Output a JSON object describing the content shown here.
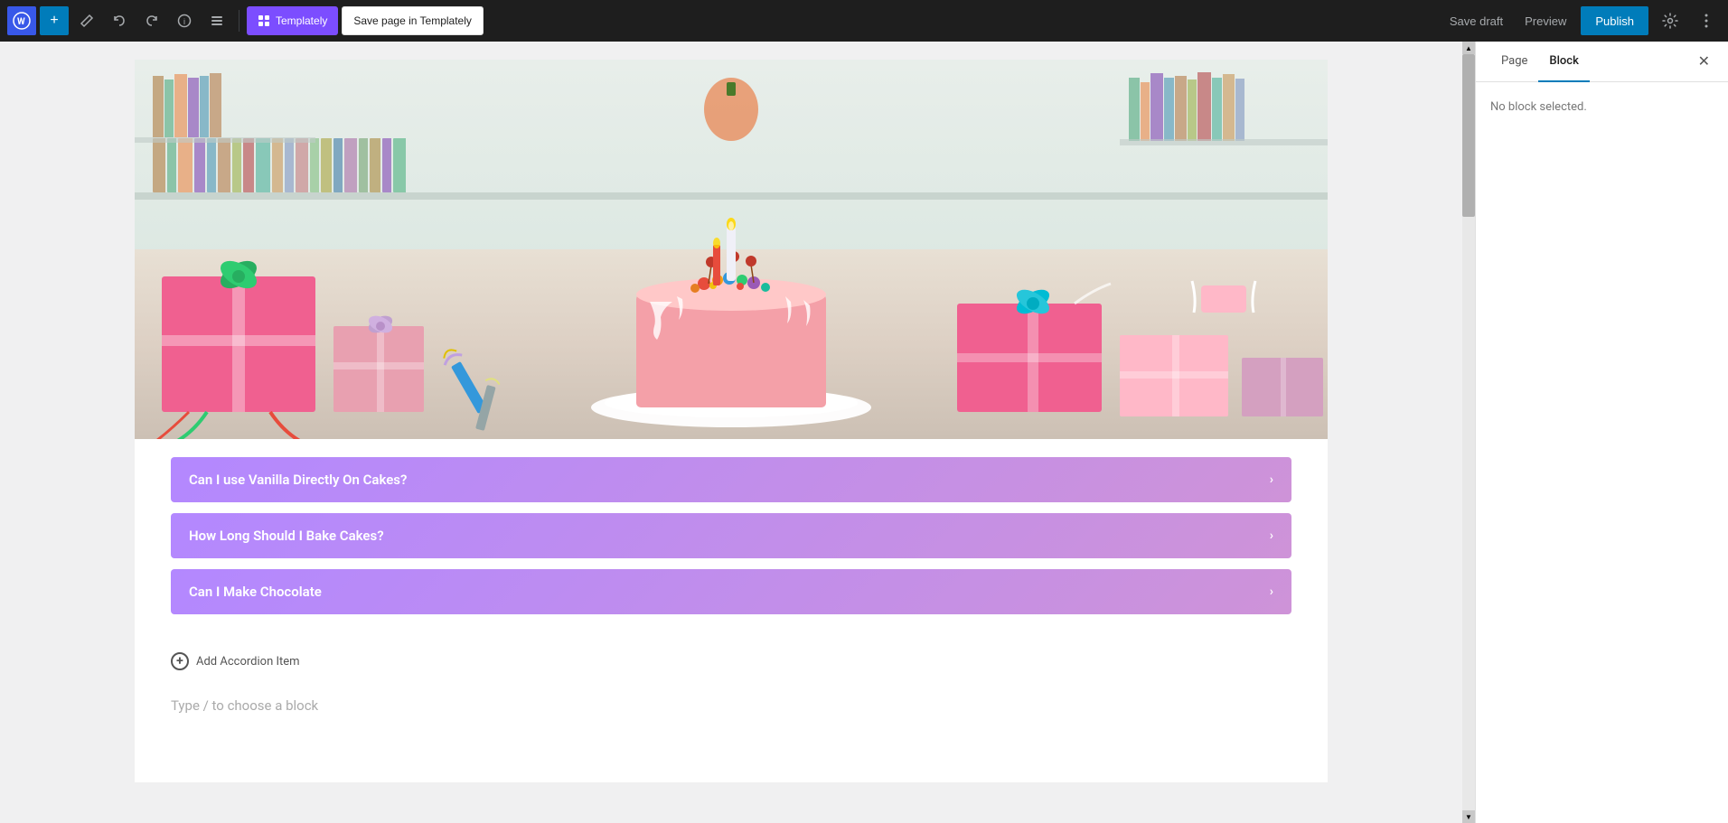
{
  "toolbar": {
    "wp_logo_label": "WordPress",
    "add_btn_label": "+",
    "tools_btn_label": "✏",
    "undo_label": "↩",
    "redo_label": "↪",
    "info_label": "ℹ",
    "list_label": "≡",
    "templately_label": "Templately",
    "save_templately_label": "Save page in Templately",
    "save_draft_label": "Save draft",
    "preview_label": "Preview",
    "publish_label": "Publish",
    "settings_label": "⚙"
  },
  "panel": {
    "page_tab": "Page",
    "block_tab": "Block",
    "close_label": "✕",
    "no_block_msg": "No block selected."
  },
  "accordion": {
    "items": [
      {
        "title": "Can I use Vanilla Directly On Cakes?"
      },
      {
        "title": "How Long Should I Bake Cakes?"
      },
      {
        "title": "Can I Make Chocolate"
      }
    ],
    "add_item_label": "Add Accordion Item"
  },
  "canvas": {
    "type_block_placeholder": "Type / to choose a block"
  },
  "scrollbar": {
    "up_arrow": "▲",
    "down_arrow": "▼"
  },
  "books": [
    {
      "color": "#c4a882",
      "width": 14
    },
    {
      "color": "#8bc4a8",
      "width": 10
    },
    {
      "color": "#e8b088",
      "width": 16
    },
    {
      "color": "#a888c8",
      "width": 12
    },
    {
      "color": "#88b8c8",
      "width": 10
    },
    {
      "color": "#c8a888",
      "width": 14
    },
    {
      "color": "#b8c888",
      "width": 10
    },
    {
      "color": "#c88888",
      "width": 12
    },
    {
      "color": "#88c8b8",
      "width": 16
    },
    {
      "color": "#d4b890",
      "width": 12
    },
    {
      "color": "#a8b8d0",
      "width": 10
    },
    {
      "color": "#d0a8a8",
      "width": 14
    },
    {
      "color": "#a8d0a8",
      "width": 10
    },
    {
      "color": "#c0c080",
      "width": 12
    },
    {
      "color": "#80a8c0",
      "width": 10
    },
    {
      "color": "#c0a0c0",
      "width": 14
    },
    {
      "color": "#a0c0a0",
      "width": 10
    },
    {
      "color": "#c0b080",
      "width": 12
    },
    {
      "color": "#a888c8",
      "width": 10
    },
    {
      "color": "#88c8a8",
      "width": 14
    }
  ]
}
